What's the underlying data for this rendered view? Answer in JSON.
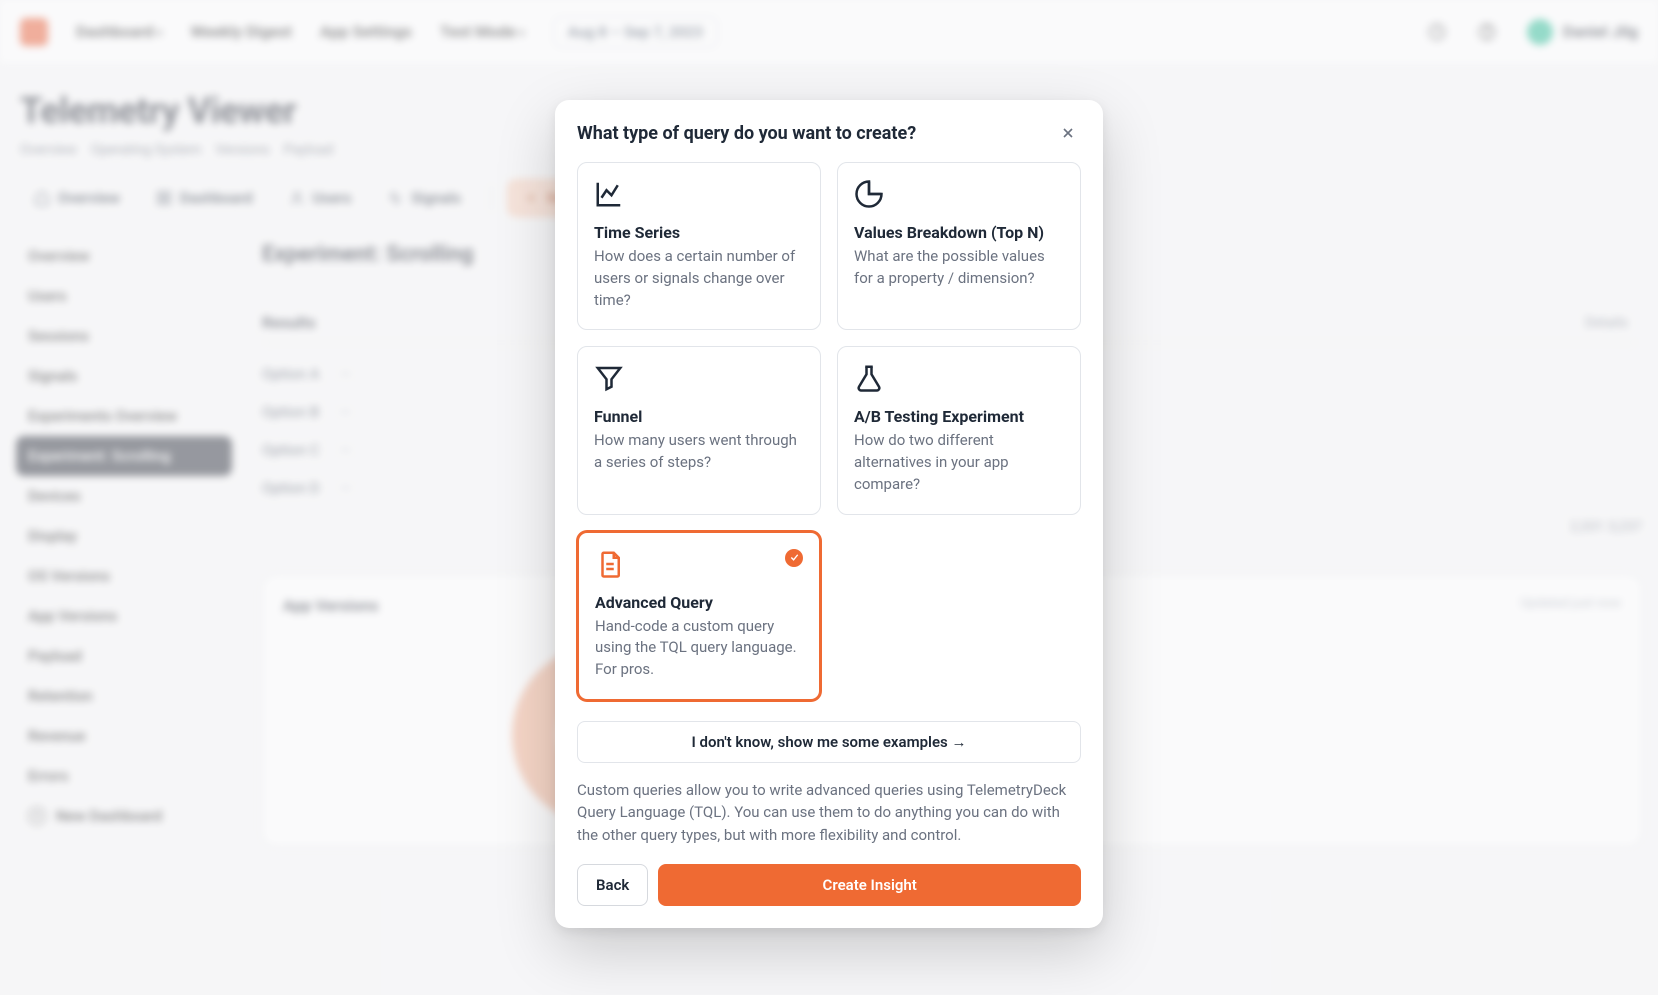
{
  "colors": {
    "accent": "#ef6a33",
    "accent_darker": "#e8572d"
  },
  "topnav": {
    "items": [
      {
        "label": "Dashboard",
        "dropdown": true
      },
      {
        "label": "Weekly Digest"
      },
      {
        "label": "App Settings"
      },
      {
        "label": "Test Mode",
        "dropdown": true
      }
    ],
    "date_range": "Aug 8 – Sep 7, 2023",
    "user_name": "Daniel Jilg"
  },
  "page": {
    "title": "Telemetry Viewer",
    "breadcrumbs": [
      "Overview",
      "Operating System",
      "Versions",
      "Payload"
    ]
  },
  "sec_tabs": [
    {
      "label": "Overview"
    },
    {
      "label": "Dashboard"
    },
    {
      "label": "Users"
    },
    {
      "label": "Signals"
    },
    {
      "label": "New"
    }
  ],
  "sidebar": {
    "items": [
      "Overview",
      "Users",
      "Sessions",
      "Signals",
      "Experiments Overview",
      "Experiment: Scrolling",
      "Devices",
      "Display",
      "OS Versions",
      "App Versions",
      "Payload",
      "Retention",
      "Revenue",
      "Errors"
    ],
    "selected_index": 5,
    "new_item": "New Dashboard"
  },
  "main": {
    "section_title": "Experiment: Scrolling",
    "results": {
      "header_left": "Results",
      "header_right": "Details",
      "items": [
        {
          "name": "Option A",
          "meta": "—"
        },
        {
          "name": "Option B",
          "meta": "—"
        },
        {
          "name": "Option C",
          "meta": "—"
        },
        {
          "name": "Option D",
          "meta": "—"
        }
      ],
      "stats_counts": "2,331   3,237"
    },
    "chart_title": "App Versions",
    "updated_note": "Updated just now"
  },
  "modal": {
    "title": "What type of query do you want to create?",
    "options": [
      {
        "key": "timeseries",
        "title": "Time Series",
        "desc": "How does a certain number of users or signals change over time?"
      },
      {
        "key": "topn",
        "title": "Values Breakdown (Top N)",
        "desc": "What are the possible values for a property / dimension?"
      },
      {
        "key": "funnel",
        "title": "Funnel",
        "desc": "How many users went through a series of steps?"
      },
      {
        "key": "abtest",
        "title": "A/B Testing Experiment",
        "desc": "How do two different alternatives in your app compare?"
      },
      {
        "key": "advanced",
        "title": "Advanced Query",
        "desc": "Hand-code a custom query using the TQL query language. For pros.",
        "selected": true
      }
    ],
    "examples_button": "I don't know, show me some examples →",
    "description": "Custom queries allow you to write advanced queries using TelemetryDeck Query Language (TQL). You can use them to do anything you can do with the other query types, but with more flexibility and control.",
    "back_button": "Back",
    "create_button": "Create Insight"
  }
}
